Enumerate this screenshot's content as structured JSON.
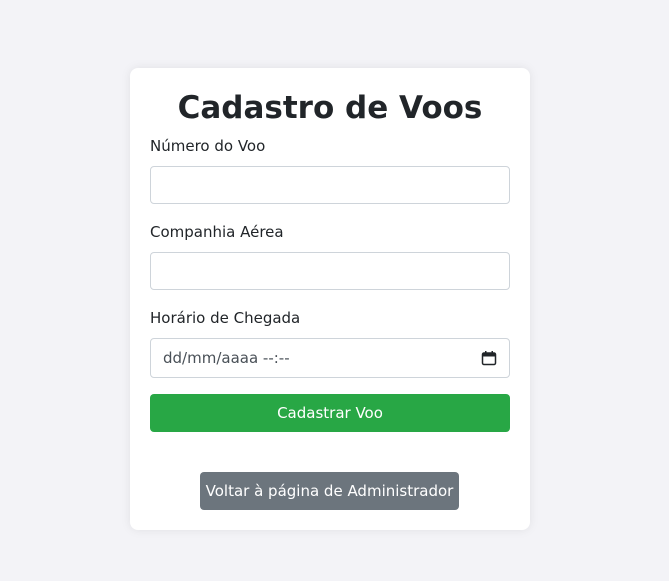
{
  "form": {
    "title": "Cadastro de Voos",
    "flight_number": {
      "label": "Número do Voo",
      "value": ""
    },
    "airline": {
      "label": "Companhia Aérea",
      "value": ""
    },
    "arrival_time": {
      "label": "Horário de Chegada",
      "placeholder": "dd/mm/aaaa --:--",
      "icon": "calendar-icon"
    },
    "submit_label": "Cadastrar Voo",
    "back_label": "Voltar à página de Administrador"
  },
  "colors": {
    "background": "#f3f3f7",
    "card": "#ffffff",
    "submit": "#28a745",
    "back": "#6c757d"
  }
}
